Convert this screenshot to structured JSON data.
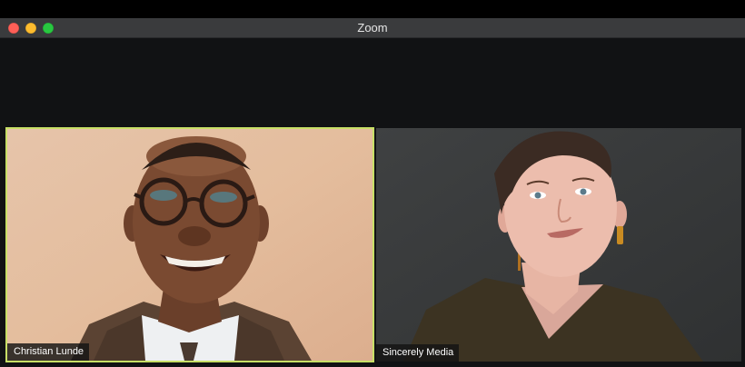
{
  "window": {
    "title": "Zoom"
  },
  "participants": [
    {
      "name": "Christian Lunde",
      "speaking": true
    },
    {
      "name": "Sincerely Media",
      "speaking": false
    }
  ],
  "colors": {
    "active_speaker_border": "#c8df66",
    "close_button": "#fe5f57",
    "minimize_button": "#febc2e",
    "zoom_button": "#28c840"
  }
}
